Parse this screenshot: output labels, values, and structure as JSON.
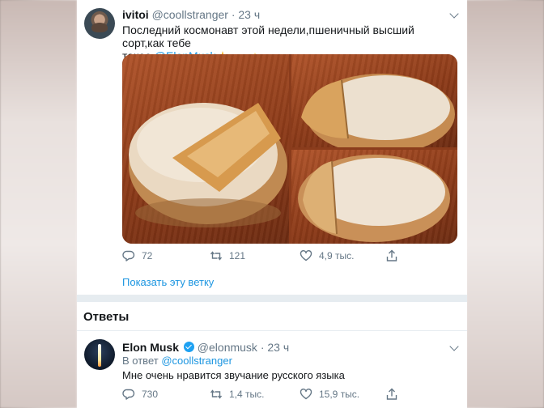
{
  "tweet": {
    "display_name": "ivitoi",
    "handle": "@coollstranger",
    "separator": "·",
    "time": "23 ч",
    "text_line1": "Последний космонавт этой недели,пшеничный высший сорт,как тебе",
    "text_line2_prefix": "такое ",
    "mention": "@ElonMusk",
    "emoji_names": [
      "sparkles-emoji",
      "flying-saucer-emoji",
      "dizzy-emoji"
    ],
    "actions": {
      "reply_count": "72",
      "retweet_count": "121",
      "like_count": "4,9 тыс."
    },
    "show_thread": "Показать эту ветку"
  },
  "replies": {
    "title": "Ответы",
    "items": [
      {
        "display_name": "Elon Musk",
        "handle": "@elonmusk",
        "separator": "·",
        "time": "23 ч",
        "reply_to_prefix": "В ответ ",
        "reply_to_handle": "@coollstranger",
        "text": "Мне очень нравится звучание русского языка",
        "actions": {
          "reply_count": "730",
          "retweet_count": "1,4 тыс.",
          "like_count": "15,9 тыс."
        }
      }
    ]
  },
  "colors": {
    "accent": "#1b95e0",
    "muted": "#657786",
    "separator": "#e6ecf0",
    "verified": "#1da1f2"
  }
}
